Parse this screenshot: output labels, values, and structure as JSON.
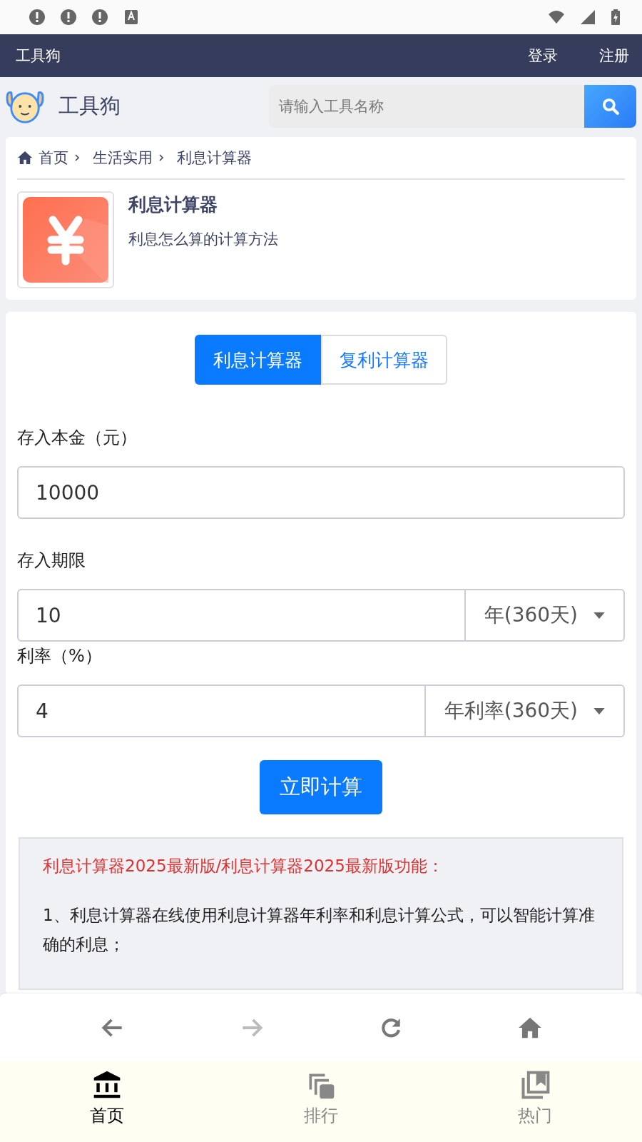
{
  "top_nav": {
    "brand": "工具狗",
    "links": [
      "登录",
      "注册"
    ]
  },
  "header": {
    "site_name": "工具狗",
    "search": {
      "placeholder": "请输入工具名称"
    }
  },
  "breadcrumb": [
    "首页",
    "生活实用",
    "利息计算器"
  ],
  "tool": {
    "title": "利息计算器",
    "subtitle": "利息怎么算的计算方法"
  },
  "tabs": [
    {
      "label": "利息计算器",
      "selected": true
    },
    {
      "label": "复利计算器",
      "selected": false
    }
  ],
  "form": [
    {
      "label": "存入本金（元）",
      "value": "10000"
    },
    {
      "label": "存入期限",
      "value": "10",
      "unit": "年(360天)"
    },
    {
      "label": "利率（%）",
      "value": "4",
      "unit": "年利率(360天)"
    }
  ],
  "submit": "立即计算",
  "info": {
    "heading": "利息计算器2025最新版/利息计算器2025最新版功能：",
    "items": [
      "1、利息计算器在线使用利息计算器年利率和利息计算公式，可以智能计算准确的利息；"
    ]
  },
  "browser_bar": [
    {
      "kind": "back",
      "disabled": false
    },
    {
      "kind": "forward",
      "disabled": true
    },
    {
      "kind": "reload",
      "disabled": false
    },
    {
      "kind": "home",
      "disabled": false
    }
  ],
  "bottom_tabs": [
    {
      "label": "首页",
      "kind": "bank",
      "selected": true
    },
    {
      "label": "排行",
      "kind": "copies",
      "selected": false
    },
    {
      "label": "热门",
      "kind": "library",
      "selected": false
    }
  ]
}
